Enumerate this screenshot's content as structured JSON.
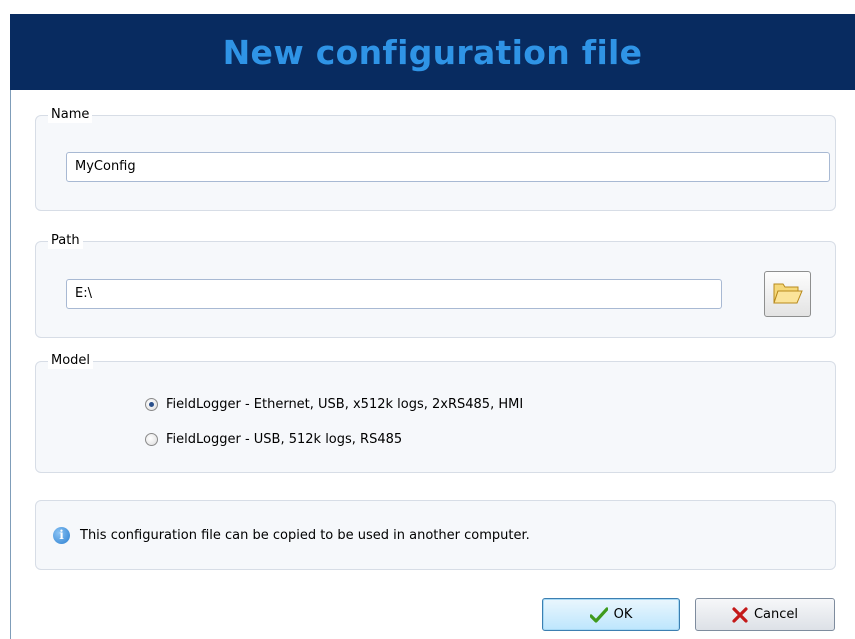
{
  "dialog": {
    "title": "New configuration file"
  },
  "name_group": {
    "legend": "Name",
    "value": "MyConfig"
  },
  "path_group": {
    "legend": "Path",
    "value": "E:\\",
    "browse_icon": "folder-open-icon"
  },
  "model_group": {
    "legend": "Model",
    "options": [
      {
        "label": "FieldLogger - Ethernet, USB, x512k logs, 2xRS485, HMI",
        "selected": true
      },
      {
        "label": "FieldLogger - USB, 512k logs, RS485",
        "selected": false
      }
    ]
  },
  "info": {
    "icon": "info-icon",
    "text": "This configuration file can be copied to be used in another computer."
  },
  "buttons": {
    "ok_label": "OK",
    "ok_icon": "checkmark-icon",
    "cancel_label": "Cancel",
    "cancel_icon": "x-icon"
  },
  "colors": {
    "titlebar_bg": "#082b60",
    "title_text": "#2f94e6",
    "check_green": "#3f9a1d",
    "cancel_red": "#c41919"
  }
}
